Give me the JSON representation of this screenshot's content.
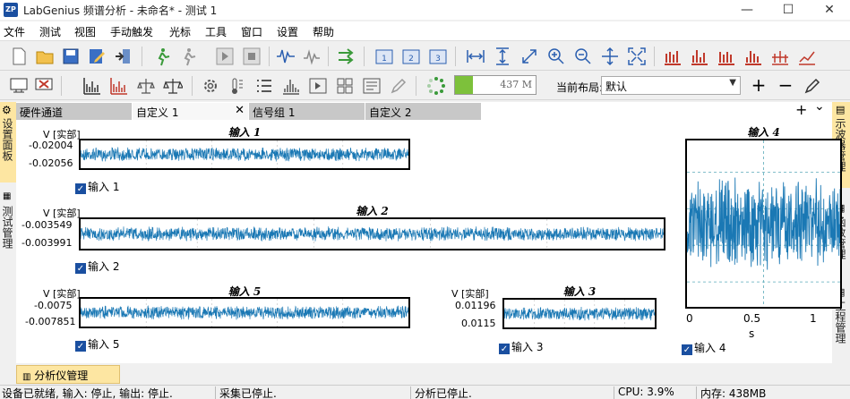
{
  "window": {
    "title": "LabGenius 频谱分析 - 未命名* - 测试 1",
    "logo": "ZP"
  },
  "menu": [
    "文件",
    "测试",
    "视图",
    "手动触发",
    "光标",
    "工具",
    "窗口",
    "设置",
    "帮助"
  ],
  "toolbar2": {
    "progress_value": "437 M",
    "layout_label": "当前布局:",
    "layout_value": "默认"
  },
  "tabs": [
    {
      "label": "硬件通道"
    },
    {
      "label": "自定义 1"
    },
    {
      "label": "信号组 1"
    },
    {
      "label": "自定义 2"
    }
  ],
  "left_panel_tabs": [
    "设置面板",
    "测试管理"
  ],
  "right_panel_tabs": [
    "示波器管理",
    "函数管理",
    "工程管理"
  ],
  "tabstrip_controls": {
    "add": "+",
    "menu": "⌄"
  },
  "charts": [
    {
      "title": "输入 1",
      "y_unit": "V [实部]",
      "y_ticks": [
        "-0.02004",
        "-0.02056"
      ],
      "legend": "输入 1",
      "checked": true
    },
    {
      "title": "输入 2",
      "y_unit": "V [实部]",
      "y_ticks": [
        "-0.003549",
        "-0.003991"
      ],
      "legend": "输入 2",
      "checked": true
    },
    {
      "title": "输入 5",
      "y_unit": "V [实部]",
      "y_ticks": [
        "-0.0075",
        "-0.007851"
      ],
      "legend": "输入 5",
      "checked": true
    },
    {
      "title": "输入 3",
      "y_unit": "V [实部]",
      "y_ticks": [
        "0.01196",
        "0.0115"
      ],
      "legend": "输入 3",
      "checked": true
    },
    {
      "title": "输入 4",
      "x_ticks": [
        "0",
        "0.5",
        "1"
      ],
      "x_unit": "s",
      "legend": "输入 4",
      "checked": true
    }
  ],
  "trace_color": "#1a78b4",
  "bottom_tab": "分析仪管理",
  "status": {
    "device": "设备已就绪, 输入: 停止, 输出: 停止.",
    "acq": "采集已停止.",
    "analysis": "分析已停止.",
    "cpu": "CPU: 3.9%",
    "mem": "内存: 438MB"
  }
}
